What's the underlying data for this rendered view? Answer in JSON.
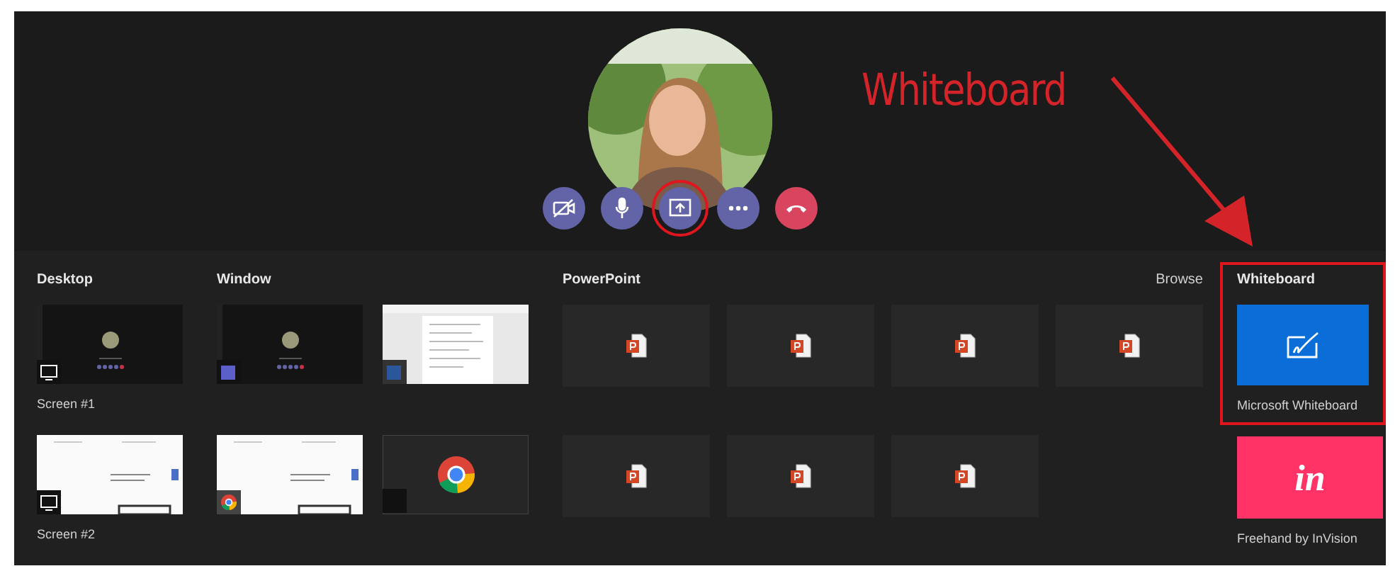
{
  "annotation": {
    "text": "Whiteboard"
  },
  "call_controls": [
    {
      "kind": "camera-off",
      "circled": false
    },
    {
      "kind": "mic",
      "circled": false
    },
    {
      "kind": "share",
      "circled": true
    },
    {
      "kind": "more",
      "circled": false
    },
    {
      "kind": "hang-up",
      "circled": false
    }
  ],
  "tray": {
    "sections": [
      {
        "kind": "desktop",
        "title": "Desktop",
        "items": [
          {
            "kind": "desktop-dark",
            "label": "Screen #1"
          },
          {
            "kind": "desktop-web",
            "label": "Screen #2"
          }
        ]
      },
      {
        "kind": "window",
        "title": "Window",
        "items": [
          {
            "kind": "teams-window"
          },
          {
            "kind": "word-window"
          },
          {
            "kind": "chrome-window"
          },
          {
            "kind": "chrome-blank"
          }
        ]
      },
      {
        "kind": "powerpoint",
        "title": "PowerPoint",
        "action": "Browse",
        "items": [
          {
            "kind": "presentation"
          },
          {
            "kind": "presentation"
          },
          {
            "kind": "presentation"
          },
          {
            "kind": "presentation"
          },
          {
            "kind": "presentation"
          },
          {
            "kind": "presentation"
          },
          {
            "kind": "presentation"
          }
        ]
      },
      {
        "kind": "whiteboard",
        "title": "Whiteboard",
        "highlighted": true,
        "items": [
          {
            "kind": "ms-whiteboard",
            "label": "Microsoft Whiteboard"
          },
          {
            "kind": "invision",
            "logo": "in",
            "label": "Freehand by InVision"
          }
        ]
      }
    ]
  }
}
